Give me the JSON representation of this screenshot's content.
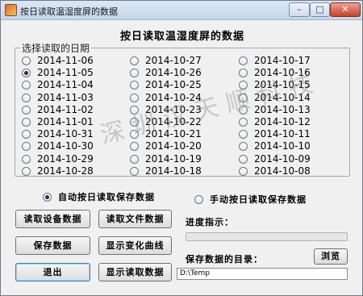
{
  "window": {
    "title": "按日读取温湿度屏的数据",
    "min_glyph": "–",
    "max_glyph": "□",
    "close_glyph": "✕"
  },
  "heading": "按日读取温湿度屏的数据",
  "date_group": {
    "legend": "选择读取的日期",
    "selected": "2014-11-05",
    "dates_col1": [
      "2014-11-06",
      "2014-11-05",
      "2014-11-04",
      "2014-11-03",
      "2014-11-02",
      "2014-11-01",
      "2014-10-31",
      "2014-10-30",
      "2014-10-29",
      "2014-10-28"
    ],
    "dates_col2": [
      "2014-10-27",
      "2014-10-26",
      "2014-10-25",
      "2014-10-24",
      "2014-10-23",
      "2014-10-22",
      "2014-10-21",
      "2014-10-20",
      "2014-10-19",
      "2014-10-18"
    ],
    "dates_col3": [
      "2014-10-17",
      "2014-10-16",
      "2014-10-15",
      "2014-10-14",
      "2014-10-13",
      "2014-10-12",
      "2014-10-11",
      "2014-10-10",
      "2014-10-09",
      "2014-10-08"
    ]
  },
  "mode": {
    "auto_label": "自动按日读取保存数据",
    "manual_label": "手动按日读取保存数据",
    "selected": "auto"
  },
  "buttons": {
    "read_device": "读取设备数据",
    "read_file": "读取文件数据",
    "save_data": "保存数据",
    "show_curve": "显示变化曲线",
    "exit": "退出",
    "show_read_data": "显示读取数据",
    "browse": "浏览"
  },
  "progress": {
    "label": "进度指示：",
    "value": 0
  },
  "save_dir": {
    "label": "保存数据的目录：",
    "value": "D:\\Temp"
  },
  "watermark": "深圳汉天顺科技"
}
